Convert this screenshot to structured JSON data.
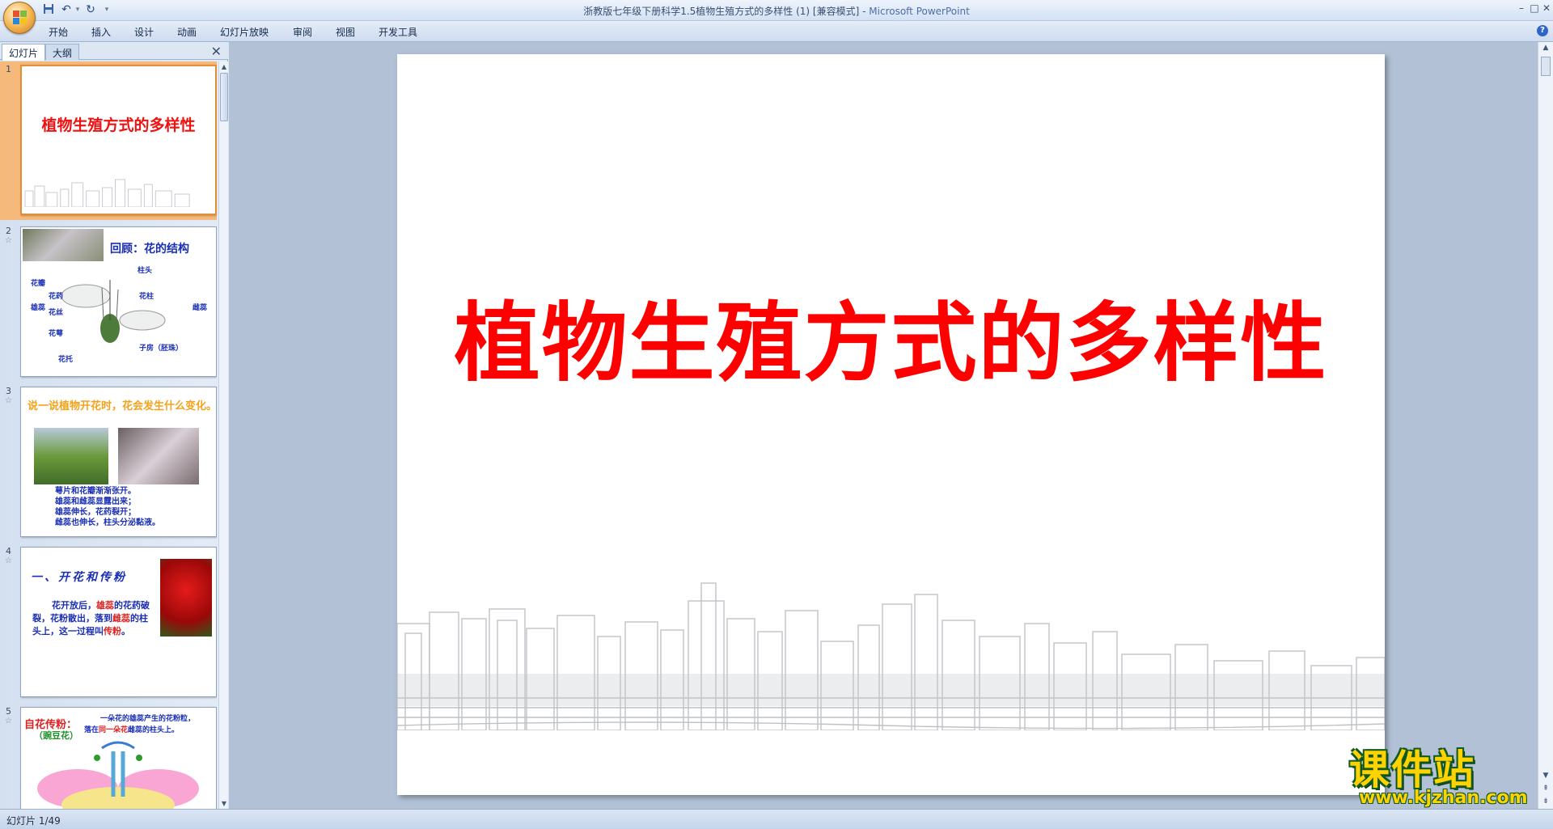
{
  "window": {
    "title": "浙教版七年级下册科学1.5植物生殖方式的多样性 (1) [兼容模式]",
    "app_name": "Microsoft PowerPoint",
    "controls": {
      "minimize": "–",
      "restore": "□",
      "close": "✕"
    }
  },
  "quick_access": {
    "save_icon": "save-icon",
    "undo_icon": "undo-icon",
    "redo_icon": "redo-icon"
  },
  "ribbon": {
    "tabs": [
      "开始",
      "插入",
      "设计",
      "动画",
      "幻灯片放映",
      "审阅",
      "视图",
      "开发工具"
    ],
    "help": "?"
  },
  "left_panel": {
    "tabs": [
      "幻灯片",
      "大纲"
    ],
    "close": "✕",
    "thumbnails": [
      {
        "number": "1",
        "title": "植物生殖方式的多样性"
      },
      {
        "number": "2",
        "title": "回顾：花的结构",
        "labels": [
          "柱头",
          "花瓣",
          "花药",
          "花柱",
          "雄蕊",
          "花丝",
          "雌蕊",
          "花萼",
          "子房（胚珠）",
          "花托"
        ]
      },
      {
        "number": "3",
        "title": "说一说植物开花时，花会发生什么变化。",
        "lines": [
          "萼片和花瓣渐渐张开。",
          "雄蕊和雌蕊显露出来；",
          "雄蕊伸长，花药裂开；",
          "雌蕊也伸长，柱头分泌黏液。"
        ]
      },
      {
        "number": "4",
        "title": "一、开花和传粉",
        "body": [
          "花开放后，",
          "雄蕊",
          "的",
          "花药破裂，花粉散出，",
          "落到",
          "雌蕊",
          "的柱头上，这",
          "一过程叫",
          "传粉",
          "。"
        ]
      },
      {
        "number": "5",
        "title": "自花传粉：",
        "subtitle": "（豌豆花）",
        "line1": "一朵花的雄蕊产生的花粉粒，",
        "line2a": "落在",
        "line2b": "同一朵花",
        "line2c": "雌蕊的柱头上。"
      }
    ]
  },
  "slide": {
    "title": "植物生殖方式的多样性",
    "title_color": "#ff0000"
  },
  "watermark": {
    "title": "课件站",
    "url": "www.kjzhan.com"
  },
  "status_bar": {
    "slide_indicator": "幻灯片 1/49"
  }
}
